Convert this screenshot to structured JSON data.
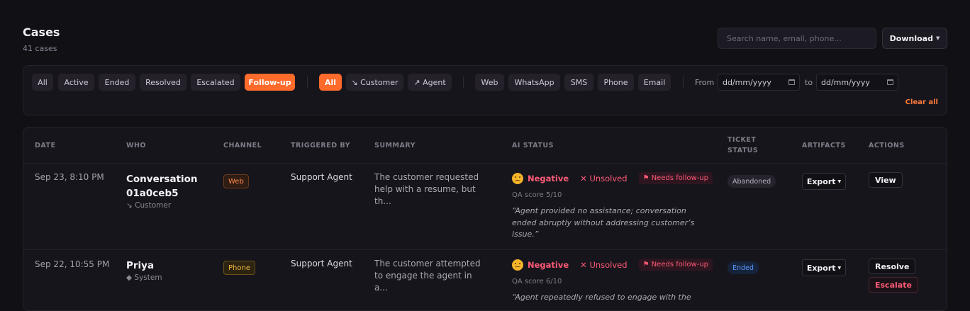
{
  "header": {
    "title": "Cases",
    "count": "41 cases",
    "search_placeholder": "Search name, email, phone...",
    "download_label": "Download"
  },
  "filters": {
    "status": [
      "All",
      "Active",
      "Ended",
      "Resolved",
      "Escalated",
      "Follow-up"
    ],
    "status_active": "Follow-up",
    "direction": [
      "All",
      "↘ Customer",
      "↗ Agent"
    ],
    "direction_active": "All",
    "channels": [
      "Web",
      "WhatsApp",
      "SMS",
      "Phone",
      "Email"
    ],
    "from_label": "From",
    "to_label": "to",
    "from_value": "dd/mm/yyyy",
    "to_value": "dd/mm/yyyy",
    "clear_all": "Clear all"
  },
  "table": {
    "columns": {
      "date": "DATE",
      "who": "WHO",
      "channel": "CHANNEL",
      "triggered_by": "TRIGGERED BY",
      "summary": "SUMMARY",
      "ai_status": "AI STATUS",
      "ticket_status_1": "TICKET",
      "ticket_status_2": "STATUS",
      "artifacts": "ARTIFACTS",
      "actions": "ACTIONS"
    },
    "rows": [
      {
        "date": "Sep 23, 8:10 PM",
        "who_line1": "Conversation",
        "who_line2": "01a0ceb5",
        "who_sub": "↘ Customer",
        "channel": "Web",
        "triggered_by": "Support Agent",
        "summary": "The customer requested help with a resume, but th...",
        "sentiment": "Negative",
        "resolution": "✕ Unsolved",
        "flag": "⚑ Needs follow-up",
        "qa": "QA score 5/10",
        "quote": "“Agent provided no assistance; conversation ended abruptly without addressing customer’s issue.”",
        "ticket_status": "Abandoned",
        "artifact": "Export",
        "actions": [
          "View"
        ]
      },
      {
        "date": "Sep 22, 10:55 PM",
        "who_line1": "Priya",
        "who_sub": "◆ System",
        "channel": "Phone",
        "triggered_by": "Support Agent",
        "summary": "The customer attempted to engage the agent in a...",
        "sentiment": "Negative",
        "resolution": "✕ Unsolved",
        "flag": "⚑ Needs follow-up",
        "qa": "QA score 6/10",
        "quote": "“Agent repeatedly refused to engage with the",
        "ticket_status": "Ended",
        "artifact": "Export",
        "actions": [
          "Resolve",
          "Escalate"
        ]
      }
    ]
  },
  "colors": {
    "accent": "#ff6b2b",
    "negative": "#ff5a76",
    "ended": "#5b9bff",
    "background": "#111015"
  }
}
